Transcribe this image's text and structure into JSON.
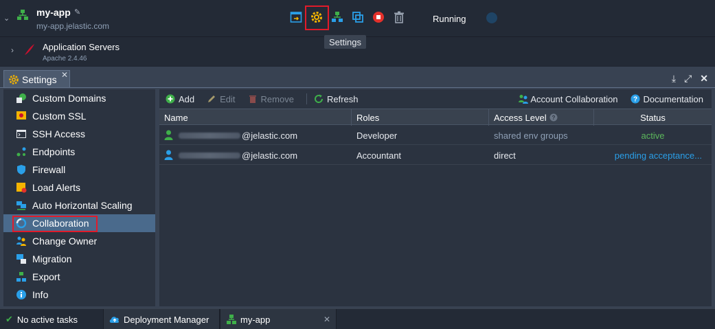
{
  "env": {
    "name": "my-app",
    "url": "my-app.jelastic.com",
    "status": "Running",
    "tooltip": "Settings"
  },
  "node": {
    "name": "Application Servers",
    "version": "Apache 2.4.46"
  },
  "settings_tab": {
    "label": "Settings"
  },
  "nav": [
    {
      "label": "Custom Domains",
      "icon": "custom-domains-icon"
    },
    {
      "label": "Custom SSL",
      "icon": "ssl-certificate-icon"
    },
    {
      "label": "SSH Access",
      "icon": "terminal-icon"
    },
    {
      "label": "Endpoints",
      "icon": "endpoints-icon"
    },
    {
      "label": "Firewall",
      "icon": "shield-icon"
    },
    {
      "label": "Load Alerts",
      "icon": "load-alerts-icon"
    },
    {
      "label": "Auto Horizontal Scaling",
      "icon": "scaling-icon"
    },
    {
      "label": "Collaboration",
      "icon": "collaboration-icon"
    },
    {
      "label": "Change Owner",
      "icon": "change-owner-icon"
    },
    {
      "label": "Migration",
      "icon": "migration-icon"
    },
    {
      "label": "Export",
      "icon": "export-icon"
    },
    {
      "label": "Info",
      "icon": "info-icon"
    }
  ],
  "toolbar": {
    "add": "Add",
    "edit": "Edit",
    "remove": "Remove",
    "refresh": "Refresh",
    "account_collaboration": "Account Collaboration",
    "documentation": "Documentation"
  },
  "table": {
    "headers": [
      "Name",
      "Roles",
      "Access Level",
      "Status"
    ],
    "rows": [
      {
        "email_domain": "@jelastic.com",
        "role": "Developer",
        "access": "shared env groups",
        "status": "active",
        "status_color": "#5cb85c"
      },
      {
        "email_domain": "@jelastic.com",
        "role": "Accountant",
        "access": "direct",
        "status": "pending acceptance...",
        "status_color": "#2a9fe8"
      }
    ]
  },
  "bottom": {
    "tasks": "No active tasks",
    "deployment_manager": "Deployment Manager",
    "env_tab": "my-app"
  },
  "colors": {
    "highlight": "#e11b2a",
    "accent": "#f4b400"
  }
}
